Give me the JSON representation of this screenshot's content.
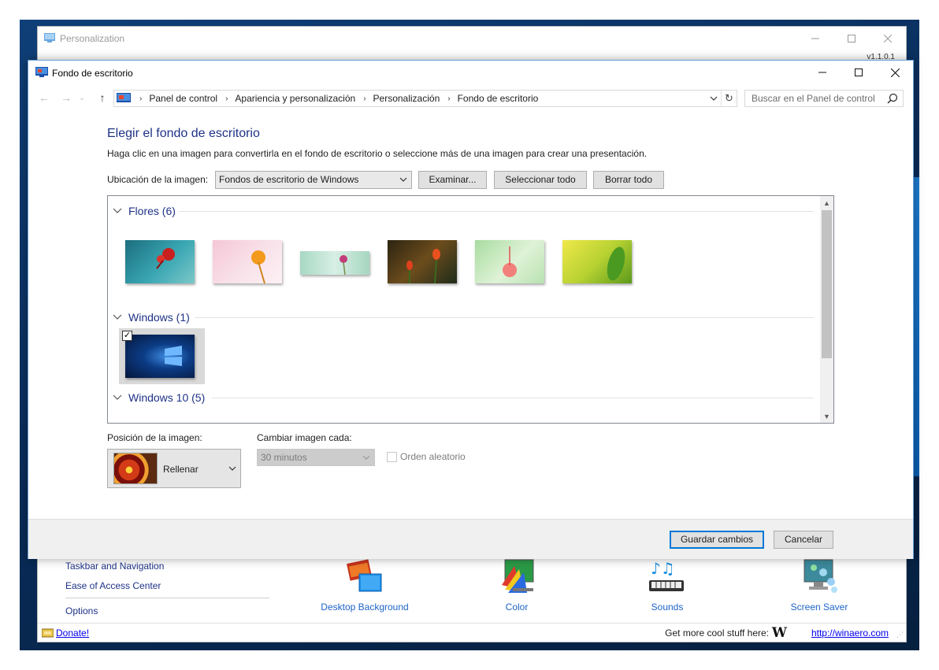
{
  "back_window": {
    "title": "Personalization",
    "version": "v1.1.0.1",
    "side_links": [
      "Taskbar and Navigation",
      "Ease of Access Center",
      "Options"
    ],
    "tools": [
      {
        "label": "Desktop Background",
        "icon": "desktop-background-icon"
      },
      {
        "label": "Color",
        "icon": "color-palette-icon"
      },
      {
        "label": "Sounds",
        "icon": "music-notes-icon"
      },
      {
        "label": "Screen Saver",
        "icon": "screen-saver-icon"
      }
    ],
    "status": {
      "donate": "Donate!",
      "more_text": "Get more cool stuff here:",
      "logo_letter": "W",
      "site": "http://winaero.com"
    }
  },
  "front_window": {
    "title": "Fondo de escritorio",
    "address": {
      "crumbs": [
        "Panel de control",
        "Apariencia y personalización",
        "Personalización",
        "Fondo de escritorio"
      ],
      "search_placeholder": "Buscar en el Panel de control"
    },
    "heading": "Elegir el fondo de escritorio",
    "description": "Haga clic en una imagen para convertirla en el fondo de escritorio o seleccione más de una imagen para crear una presentación.",
    "location_label": "Ubicación de la imagen:",
    "location_value": "Fondos de escritorio de Windows",
    "buttons": {
      "browse": "Examinar...",
      "select_all": "Seleccionar todo",
      "clear_all": "Borrar todo",
      "save": "Guardar cambios",
      "cancel": "Cancelar"
    },
    "groups": [
      {
        "name": "Flores (6)"
      },
      {
        "name": "Windows (1)"
      },
      {
        "name": "Windows 10 (5)"
      }
    ],
    "position_label": "Posición de la imagen:",
    "position_value": "Rellenar",
    "interval_label": "Cambiar imagen cada:",
    "interval_value": "30 minutos",
    "shuffle_label": "Orden aleatorio",
    "colors": {
      "accent": "#0078d7",
      "heading": "#1e3287",
      "link": "#1e64c8"
    }
  }
}
